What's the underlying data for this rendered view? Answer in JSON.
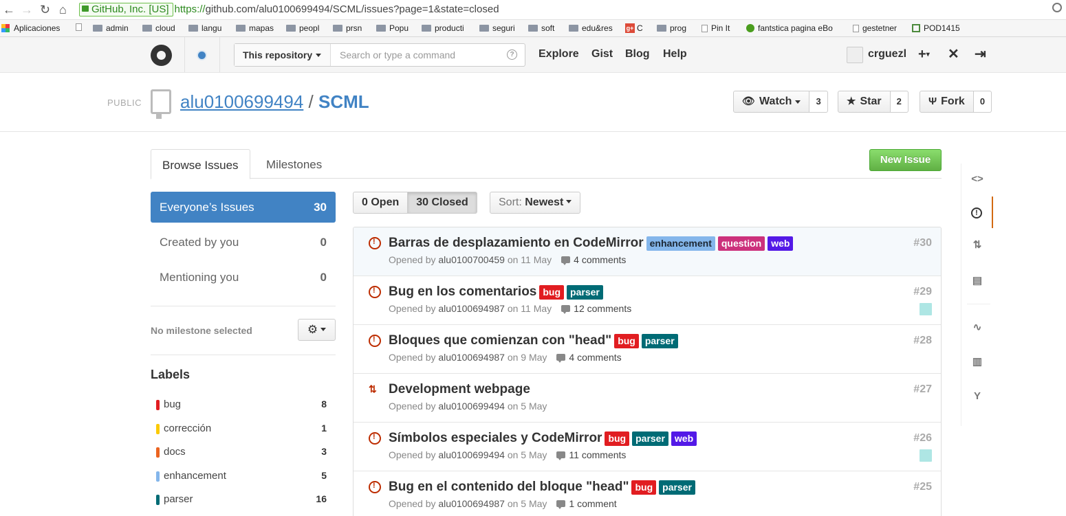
{
  "browser": {
    "ev_label": "GitHub, Inc. [US]",
    "url_scheme": "https://",
    "url_rest": "github.com/alu0100699494/SCML/issues?page=1&state=closed",
    "bookmarks": [
      "Aplicaciones",
      "admin",
      "cloud",
      "langu",
      "mapas",
      "peopl",
      "prsn",
      "Popu",
      "producti",
      "seguri",
      "soft",
      "edu&res",
      "C",
      "prog",
      "Pin It",
      "fantstica pagina eBo",
      "gestetner",
      "POD1415"
    ]
  },
  "header": {
    "scope": "This repository",
    "search_placeholder": "Search or type a command",
    "help": "?",
    "nav": [
      "Explore",
      "Gist",
      "Blog",
      "Help"
    ],
    "username": "crguezl",
    "plus": "+",
    "tools_icon": "✕",
    "signout_icon": "⇥"
  },
  "repo": {
    "visibility": "PUBLIC",
    "owner": "alu0100699494",
    "separator": "/",
    "name": "SCML",
    "watch_label": "Watch",
    "watch_count": "3",
    "star_label": "Star",
    "star_count": "2",
    "fork_label": "Fork",
    "fork_count": "0"
  },
  "tabs": {
    "browse": "Browse Issues",
    "milestones": "Milestones",
    "new_issue": "New Issue"
  },
  "sidebar": {
    "filters": [
      {
        "label": "Everyone’s Issues",
        "count": "30"
      },
      {
        "label": "Created by you",
        "count": "0"
      },
      {
        "label": "Mentioning you",
        "count": "0"
      }
    ],
    "milestone_text": "No milestone selected",
    "labels_heading": "Labels",
    "labels": [
      {
        "name": "bug",
        "count": "8",
        "color": "#e11d21"
      },
      {
        "name": "corrección",
        "count": "1",
        "color": "#fbca04"
      },
      {
        "name": "docs",
        "count": "3",
        "color": "#eb6420"
      },
      {
        "name": "enhancement",
        "count": "5",
        "color": "#84b6eb"
      },
      {
        "name": "parser",
        "count": "16",
        "color": "#006b75"
      }
    ]
  },
  "controls": {
    "open": "0 Open",
    "closed": "30 Closed",
    "sort_prefix": "Sort:",
    "sort_value": "Newest"
  },
  "label_colors": {
    "bug": {
      "bg": "#e11d21",
      "fg": "#ffffff"
    },
    "parser": {
      "bg": "#006b75",
      "fg": "#ffffff"
    },
    "enhancement": {
      "bg": "#84b6eb",
      "fg": "#1c2733"
    },
    "question": {
      "bg": "#cc317c",
      "fg": "#ffffff"
    },
    "web": {
      "bg": "#5319e7",
      "fg": "#ffffff"
    }
  },
  "issues": [
    {
      "title": "Barras de desplazamiento en CodeMirror",
      "labels": [
        "enhancement",
        "question",
        "web"
      ],
      "opened_prefix": "Opened by",
      "author": "alu0100700459",
      "date": "on 11 May",
      "comments": "4 comments",
      "number": "#30",
      "assignee": false,
      "type": "issue"
    },
    {
      "title": "Bug en los comentarios",
      "labels": [
        "bug",
        "parser"
      ],
      "opened_prefix": "Opened by",
      "author": "alu0100694987",
      "date": "on 11 May",
      "comments": "12 comments",
      "number": "#29",
      "assignee": true,
      "type": "issue"
    },
    {
      "title": "Bloques que comienzan con \"head\"",
      "labels": [
        "bug",
        "parser"
      ],
      "opened_prefix": "Opened by",
      "author": "alu0100694987",
      "date": "on 9 May",
      "comments": "4 comments",
      "number": "#28",
      "assignee": false,
      "type": "issue"
    },
    {
      "title": "Development webpage",
      "labels": [],
      "opened_prefix": "Opened by",
      "author": "alu0100699494",
      "date": "on 5 May",
      "comments": "",
      "number": "#27",
      "assignee": false,
      "type": "pr"
    },
    {
      "title": "Símbolos especiales y CodeMirror",
      "labels": [
        "bug",
        "parser",
        "web"
      ],
      "opened_prefix": "Opened by",
      "author": "alu0100699494",
      "date": "on 5 May",
      "comments": "11 comments",
      "number": "#26",
      "assignee": true,
      "type": "issue"
    },
    {
      "title": "Bug en el contenido del bloque \"head\"",
      "labels": [
        "bug",
        "parser"
      ],
      "opened_prefix": "Opened by",
      "author": "alu0100694987",
      "date": "on 5 May",
      "comments": "1 comment",
      "number": "#25",
      "assignee": false,
      "type": "issue"
    }
  ],
  "reponav": [
    {
      "name": "code",
      "glyph": "<>"
    },
    {
      "name": "issues",
      "glyph": "!"
    },
    {
      "name": "pull-requests",
      "glyph": "⇅"
    },
    {
      "name": "wiki",
      "glyph": "▤"
    },
    {
      "name": "pulse",
      "glyph": "∿"
    },
    {
      "name": "graphs",
      "glyph": "▥"
    },
    {
      "name": "network",
      "glyph": "Y"
    }
  ]
}
